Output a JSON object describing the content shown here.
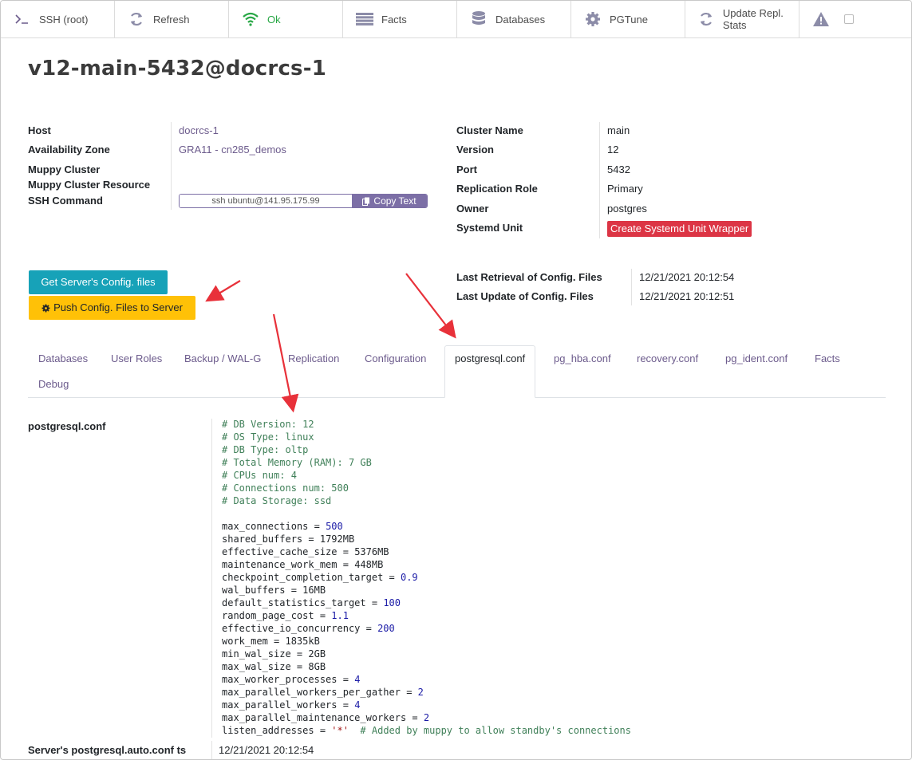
{
  "button_box": {
    "items": [
      {
        "label": "SSH (root)",
        "icon": "terminal-icon"
      },
      {
        "label": "Refresh",
        "icon": "refresh-icon"
      },
      {
        "label": "Ok",
        "icon": "wifi-icon"
      },
      {
        "label": "Facts",
        "icon": "list-icon"
      },
      {
        "label": "Databases",
        "icon": "database-icon"
      },
      {
        "label": "PGTune",
        "icon": "gear-icon"
      },
      {
        "label": "Update Repl. Stats",
        "icon": "refresh-icon"
      }
    ],
    "warning_icon": "warning-icon"
  },
  "title": "v12-main-5432@docrcs-1",
  "left_fields": {
    "host_label": "Host",
    "host_value": "docrcs-1",
    "az_label": "Availability Zone",
    "az_value": "GRA11 - cn285_demos",
    "muppy_cluster_label": "Muppy Cluster",
    "muppy_cluster_resource_label": "Muppy Cluster Resource",
    "ssh_label": "SSH Command",
    "ssh_value": "ssh ubuntu@141.95.175.99",
    "copy_label": "Copy Text"
  },
  "right_fields": {
    "cluster_name_label": "Cluster Name",
    "cluster_name_value": "main",
    "version_label": "Version",
    "version_value": "12",
    "port_label": "Port",
    "port_value": "5432",
    "replication_role_label": "Replication Role",
    "replication_role_value": "Primary",
    "owner_label": "Owner",
    "owner_value": "postgres",
    "systemd_label": "Systemd Unit",
    "systemd_button": "Create Systemd Unit Wrapper"
  },
  "actions": {
    "get_config": "Get Server's Config. files",
    "push_config": "Push Config. Files to Server"
  },
  "retrieval": {
    "last_retrieval_label": "Last Retrieval of Config. Files",
    "last_retrieval_value": "12/21/2021 20:12:54",
    "last_update_label": "Last Update of Config. Files",
    "last_update_value": "12/21/2021 20:12:51"
  },
  "tabs": [
    "Databases",
    "User Roles",
    "Backup / WAL-G",
    "Replication",
    "Configuration",
    "postgresql.conf",
    "pg_hba.conf",
    "recovery.conf",
    "pg_ident.conf",
    "Facts",
    "Debug"
  ],
  "active_tab": "postgresql.conf",
  "conf": {
    "label": "postgresql.conf",
    "comments": [
      "# DB Version: 12",
      "# OS Type: linux",
      "# DB Type: oltp",
      "# Total Memory (RAM): 7 GB",
      "# CPUs num: 4",
      "# Connections num: 500",
      "# Data Storage: ssd"
    ],
    "settings": [
      {
        "key": "max_connections",
        "value": "500",
        "numeric": true
      },
      {
        "key": "shared_buffers",
        "value": "1792MB",
        "numeric": false
      },
      {
        "key": "effective_cache_size",
        "value": "5376MB",
        "numeric": false
      },
      {
        "key": "maintenance_work_mem",
        "value": "448MB",
        "numeric": false
      },
      {
        "key": "checkpoint_completion_target",
        "value": "0.9",
        "numeric": true
      },
      {
        "key": "wal_buffers",
        "value": "16MB",
        "numeric": false
      },
      {
        "key": "default_statistics_target",
        "value": "100",
        "numeric": true
      },
      {
        "key": "random_page_cost",
        "value": "1.1",
        "numeric": true
      },
      {
        "key": "effective_io_concurrency",
        "value": "200",
        "numeric": true
      },
      {
        "key": "work_mem",
        "value": "1835kB",
        "numeric": false
      },
      {
        "key": "min_wal_size",
        "value": "2GB",
        "numeric": false
      },
      {
        "key": "max_wal_size",
        "value": "8GB",
        "numeric": false
      },
      {
        "key": "max_worker_processes",
        "value": "4",
        "numeric": true
      },
      {
        "key": "max_parallel_workers_per_gather",
        "value": "2",
        "numeric": true
      },
      {
        "key": "max_parallel_workers",
        "value": "4",
        "numeric": true
      },
      {
        "key": "max_parallel_maintenance_workers",
        "value": "2",
        "numeric": true
      }
    ],
    "listen_key": "listen_addresses",
    "listen_value": "'*'",
    "listen_comment": "# Added by muppy to allow standby's connections"
  },
  "auto_conf": {
    "label": "Server's postgresql.auto.conf ts",
    "value": "12/21/2021 20:12:54"
  },
  "colors": {
    "accent": "#7c6fa6",
    "teal": "#17a2b8",
    "warning": "#ffc107",
    "danger": "#dc3545",
    "ok": "#28a745",
    "annotation_arrow": "#e8313a"
  }
}
